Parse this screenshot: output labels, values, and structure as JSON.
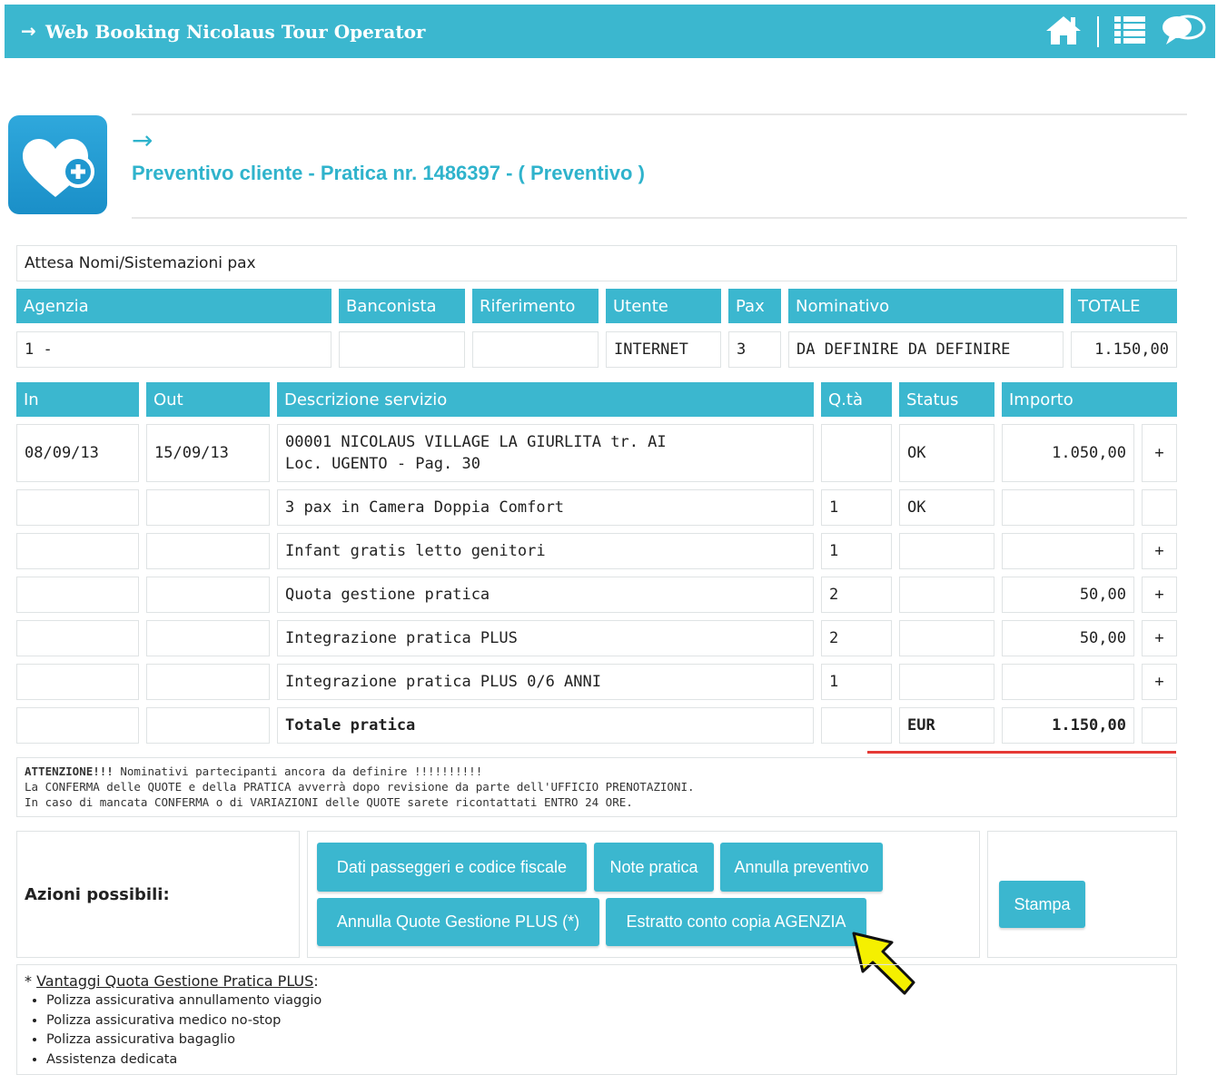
{
  "header": {
    "title": "Web Booking Nicolaus Tour Operator",
    "icons": [
      "home-icon",
      "list-icon",
      "chat-icon"
    ]
  },
  "page": {
    "title": "Preventivo cliente - Pratica nr. 1486397 - ( Preventivo )",
    "status_line": "Attesa Nomi/Sistemazioni pax"
  },
  "summary": {
    "headers": [
      "Agenzia",
      "Banconista",
      "Riferimento",
      "Utente",
      "Pax",
      "Nominativo",
      "TOTALE"
    ],
    "values": [
      "1 -",
      "",
      "",
      "INTERNET",
      "3",
      "DA DEFINIRE DA DEFINIRE",
      "1.150,00"
    ]
  },
  "services": {
    "headers": [
      "In",
      "Out",
      "Descrizione servizio",
      "Q.tà",
      "Status",
      "Importo"
    ],
    "rows": [
      {
        "in": "08/09/13",
        "out": "15/09/13",
        "desc1": "00001 NICOLAUS VILLAGE LA GIURLITA tr. AI",
        "desc2": "Loc. UGENTO - Pag. 30",
        "qty": "",
        "status": "OK",
        "amount": "1.050,00",
        "plus": "+"
      },
      {
        "in": "",
        "out": "",
        "desc1": "3 pax in Camera Doppia Comfort",
        "qty": "1",
        "status": "OK",
        "amount": "",
        "plus": ""
      },
      {
        "in": "",
        "out": "",
        "desc1": "Infant gratis letto genitori",
        "qty": "1",
        "status": "",
        "amount": "",
        "plus": "+"
      },
      {
        "in": "",
        "out": "",
        "desc1": "Quota gestione pratica",
        "qty": "2",
        "status": "",
        "amount": "50,00",
        "plus": "+"
      },
      {
        "in": "",
        "out": "",
        "desc1": "Integrazione pratica PLUS",
        "qty": "2",
        "status": "",
        "amount": "50,00",
        "plus": "+"
      },
      {
        "in": "",
        "out": "",
        "desc1": "Integrazione pratica PLUS 0/6 ANNI",
        "qty": "1",
        "status": "",
        "amount": "",
        "plus": "+"
      }
    ],
    "total": {
      "label": "Totale pratica",
      "currency": "EUR",
      "amount": "1.150,00"
    }
  },
  "notice": {
    "bold": "ATTENZIONE!!!",
    "line1": " Nominativi partecipanti ancora da definire !!!!!!!!!!",
    "line2": "La CONFERMA delle QUOTE e della PRATICA avverrà dopo revisione da parte dell'UFFICIO PRENOTAZIONI.",
    "line3": "In caso di mancata CONFERMA o di VARIAZIONI delle QUOTE sarete ricontattati ENTRO 24 ORE."
  },
  "actions": {
    "label": "Azioni possibili:",
    "buttons": [
      "Dati passeggeri e codice fiscale",
      "Note pratica",
      "Annulla preventivo",
      "Annulla Quote Gestione PLUS (*)",
      "Estratto conto copia AGENZIA"
    ],
    "print": "Stampa"
  },
  "advantages": {
    "prefix": "* ",
    "title": "Vantaggi Quota Gestione Pratica PLUS",
    "suffix": ":",
    "items": [
      "Polizza assicurativa annullamento viaggio",
      "Polizza assicurativa medico no-stop",
      "Polizza assicurativa bagaglio",
      "Assistenza dedicata"
    ]
  },
  "colors": {
    "accent": "#3bb7cf",
    "title": "#2fb3cc",
    "highlight": "#e53935",
    "pointer": "#f5f000"
  }
}
